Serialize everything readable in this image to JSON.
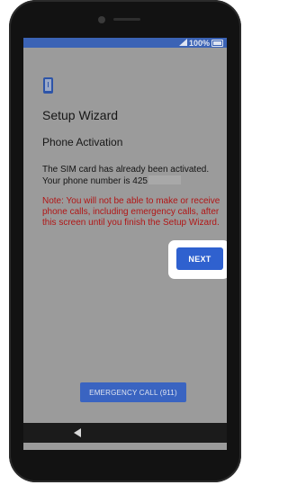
{
  "status_bar": {
    "battery_percent": "100%",
    "signal_icon": "signal-icon",
    "battery_icon": "battery-icon"
  },
  "header": {
    "icon": "phone-icon",
    "title": "Setup Wizard"
  },
  "main": {
    "subtitle": "Phone Activation",
    "info_line1": "The SIM card has already been activated.",
    "info_line2": "Your phone number is 425",
    "note": "Note: You will not be able to make or receive phone calls, including emergency calls, after this screen until you finish the Setup Wizard.",
    "note_color": "#b11616"
  },
  "buttons": {
    "next_label": "NEXT",
    "emergency_label": "EMERGENCY CALL (911)",
    "accent_color": "#2f61cf"
  },
  "nav_bar": {
    "back_icon": "back-triangle-icon"
  }
}
